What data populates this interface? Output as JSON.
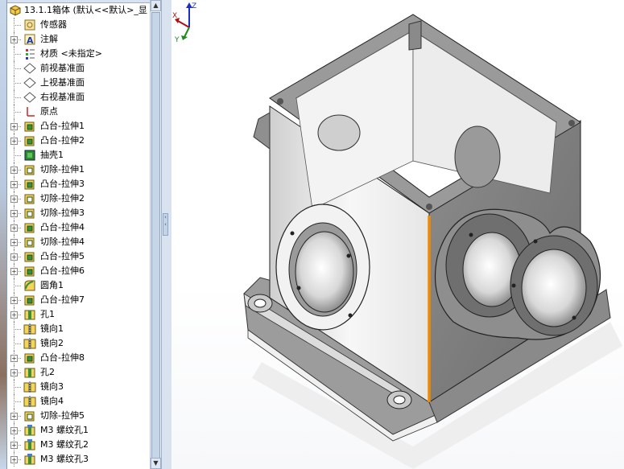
{
  "tree": {
    "root_label": "13.1.1箱体 (默认<<默认>_显",
    "items": [
      {
        "label": "传感器",
        "icon": "sensor-icon",
        "expandable": false
      },
      {
        "label": "注解",
        "icon": "annotation-icon",
        "expandable": true
      },
      {
        "label": "材质 <未指定>",
        "icon": "material-icon",
        "expandable": false
      },
      {
        "label": "前视基准面",
        "icon": "plane-icon",
        "expandable": false
      },
      {
        "label": "上视基准面",
        "icon": "plane-icon",
        "expandable": false
      },
      {
        "label": "右视基准面",
        "icon": "plane-icon",
        "expandable": false
      },
      {
        "label": "原点",
        "icon": "origin-icon",
        "expandable": false
      },
      {
        "label": "凸台-拉伸1",
        "icon": "boss-extrude-icon",
        "expandable": true
      },
      {
        "label": "凸台-拉伸2",
        "icon": "boss-extrude-icon",
        "expandable": true
      },
      {
        "label": "抽壳1",
        "icon": "shell-icon",
        "expandable": false
      },
      {
        "label": "切除-拉伸1",
        "icon": "cut-extrude-icon",
        "expandable": true
      },
      {
        "label": "凸台-拉伸3",
        "icon": "boss-extrude-icon",
        "expandable": true
      },
      {
        "label": "切除-拉伸2",
        "icon": "cut-extrude-icon",
        "expandable": true
      },
      {
        "label": "切除-拉伸3",
        "icon": "cut-extrude-icon",
        "expandable": true
      },
      {
        "label": "凸台-拉伸4",
        "icon": "boss-extrude-icon",
        "expandable": true
      },
      {
        "label": "切除-拉伸4",
        "icon": "cut-extrude-icon",
        "expandable": true
      },
      {
        "label": "凸台-拉伸5",
        "icon": "boss-extrude-icon",
        "expandable": true
      },
      {
        "label": "凸台-拉伸6",
        "icon": "boss-extrude-icon",
        "expandable": true
      },
      {
        "label": "圆角1",
        "icon": "fillet-icon",
        "expandable": false
      },
      {
        "label": "凸台-拉伸7",
        "icon": "boss-extrude-icon",
        "expandable": true
      },
      {
        "label": "孔1",
        "icon": "hole-icon",
        "expandable": true
      },
      {
        "label": "镜向1",
        "icon": "mirror-icon",
        "expandable": false
      },
      {
        "label": "镜向2",
        "icon": "mirror-icon",
        "expandable": false
      },
      {
        "label": "凸台-拉伸8",
        "icon": "boss-extrude-icon",
        "expandable": true
      },
      {
        "label": "孔2",
        "icon": "hole-icon",
        "expandable": true
      },
      {
        "label": "镜向3",
        "icon": "mirror-icon",
        "expandable": false
      },
      {
        "label": "镜向4",
        "icon": "mirror-icon",
        "expandable": false
      },
      {
        "label": "切除-拉伸5",
        "icon": "cut-extrude-icon",
        "expandable": true
      },
      {
        "label": "M3 螺纹孔1",
        "icon": "hole-wizard-icon",
        "expandable": true
      },
      {
        "label": "M3 螺纹孔2",
        "icon": "hole-wizard-icon",
        "expandable": true
      },
      {
        "label": "M3 螺纹孔3",
        "icon": "hole-wizard-icon",
        "expandable": true
      }
    ]
  },
  "triad": {
    "x": "X",
    "y": "Y",
    "z": "Z"
  },
  "colors": {
    "selected_edge": "#f08a00",
    "part_gray": "#a9a9a9",
    "face_white": "#f4f4f4",
    "tree_line": "#888888"
  }
}
